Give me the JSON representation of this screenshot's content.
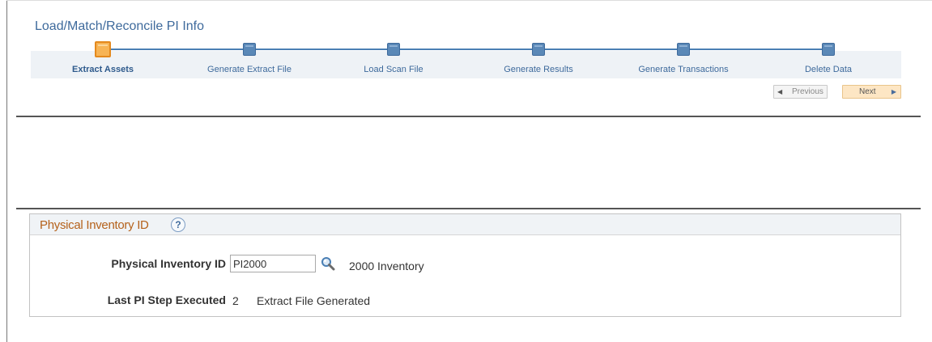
{
  "page": {
    "title": "Load/Match/Reconcile PI Info"
  },
  "train": {
    "steps": [
      {
        "label": "Extract Assets",
        "active": true
      },
      {
        "label": "Generate Extract File",
        "active": false
      },
      {
        "label": "Load Scan File",
        "active": false
      },
      {
        "label": "Generate Results",
        "active": false
      },
      {
        "label": "Generate Transactions",
        "active": false
      },
      {
        "label": "Delete Data",
        "active": false
      }
    ]
  },
  "nav": {
    "previous_label": "Previous",
    "next_label": "Next",
    "prev_arrow": "◀",
    "next_arrow": "▶"
  },
  "group": {
    "title": "Physical Inventory ID",
    "help_glyph": "?",
    "pi_id_label": "Physical Inventory ID",
    "pi_id_value": "PI2000",
    "pi_description": "2000 Inventory",
    "last_step_label": "Last PI Step Executed",
    "last_step_number": "2",
    "last_step_description": "Extract File Generated"
  },
  "colors": {
    "title_blue": "#3e6a9c",
    "group_title_orange": "#b5621c",
    "active_step": "#f7b455",
    "next_button": "#fde6c4"
  }
}
